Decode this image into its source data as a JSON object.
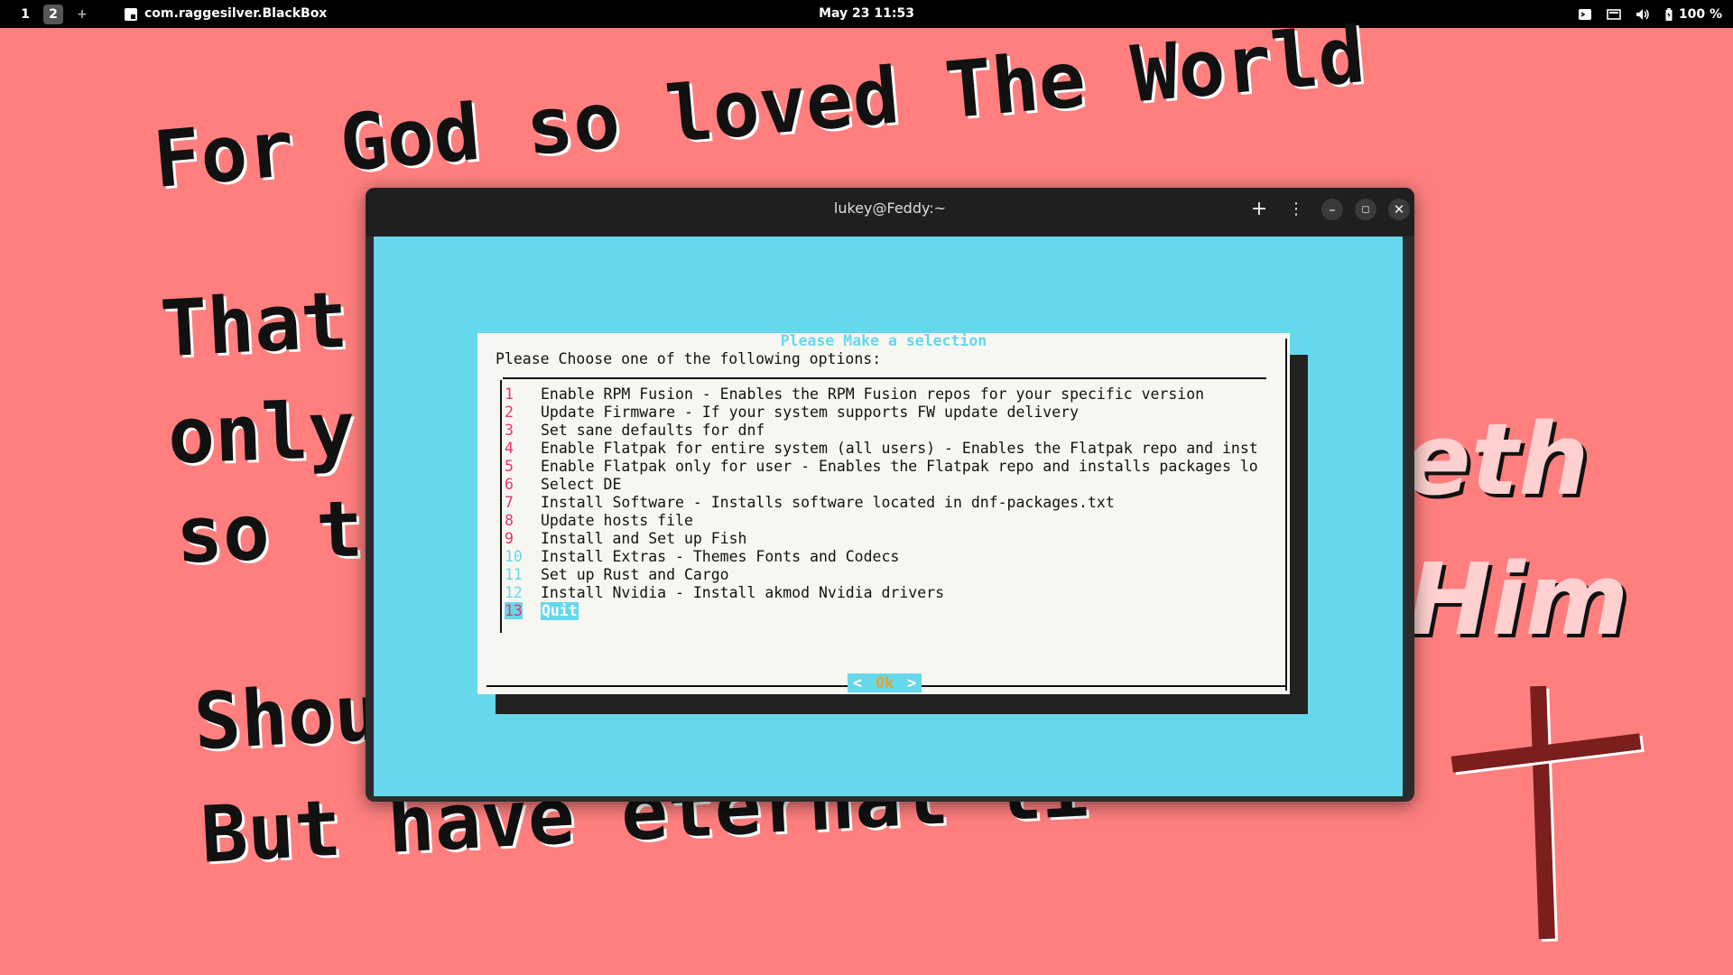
{
  "topbar": {
    "workspaces": [
      "1",
      "2",
      "+"
    ],
    "active_workspace": "2",
    "app_name": "com.raggesilver.BlackBox",
    "clock": "May 23  11:53",
    "battery": "100 %",
    "icons": [
      "terminal-icon",
      "screen-icon",
      "volume-icon",
      "battery-icon"
    ]
  },
  "wallpaper": {
    "line1": "For God so loved The World",
    "line2": "That",
    "line3": "only",
    "line4": "so t",
    "line5": "Shou",
    "line6": "But have eternal li",
    "italic1": "eth",
    "italic2": "Him"
  },
  "window": {
    "title": "lukey@Feddy:~",
    "buttons": [
      "new-tab",
      "menu",
      "minimize",
      "maximize",
      "close"
    ]
  },
  "dialog": {
    "title": "Please Make a selection",
    "prompt": "Please Choose one of the following options:",
    "items": [
      {
        "num": "1",
        "label": "Enable RPM Fusion - Enables the RPM Fusion repos for your specific version"
      },
      {
        "num": "2",
        "label": "Update Firmware - If your system supports FW update delivery"
      },
      {
        "num": "3",
        "label": "Set sane defaults for dnf"
      },
      {
        "num": "4",
        "label": "Enable Flatpak for entire system (all users) - Enables the Flatpak repo and inst"
      },
      {
        "num": "5",
        "label": "Enable Flatpak only for user - Enables the Flatpak repo and installs packages lo"
      },
      {
        "num": "6",
        "label": "Select DE"
      },
      {
        "num": "7",
        "label": "Install Software - Installs software located in dnf-packages.txt"
      },
      {
        "num": "8",
        "label": "Update hosts file"
      },
      {
        "num": "9",
        "label": "Install and Set up Fish"
      },
      {
        "num": "10",
        "label": "Install Extras - Themes Fonts and Codecs"
      },
      {
        "num": "11",
        "label": "Set up Rust and Cargo"
      },
      {
        "num": "12",
        "label": "Install Nvidia - Install akmod Nvidia drivers"
      },
      {
        "num": "13",
        "label": "Quit"
      }
    ],
    "selected": "13",
    "ok_label": "Ok",
    "ok_left": "<",
    "ok_right": ">"
  },
  "colors": {
    "wallpaper": "#ff7f7f",
    "terminal_bg": "#66d8ec",
    "accent_number": "#e8326e",
    "ok_text": "#e8a030"
  }
}
